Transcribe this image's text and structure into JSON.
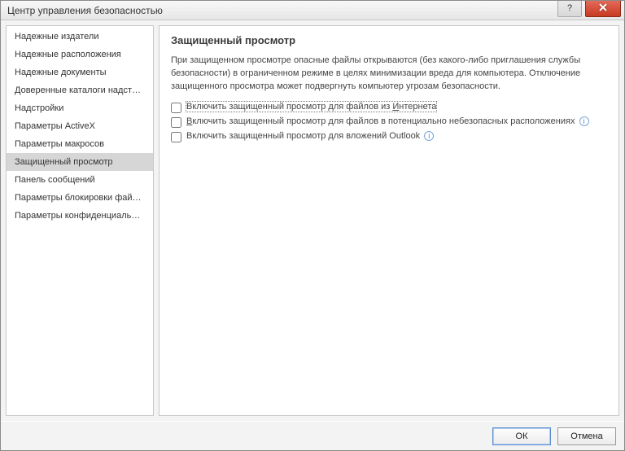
{
  "window": {
    "title": "Центр управления безопасностью"
  },
  "sidebar": {
    "items": [
      {
        "label": "Надежные издатели"
      },
      {
        "label": "Надежные расположения"
      },
      {
        "label": "Надежные документы"
      },
      {
        "label": "Доверенные каталоги надстроек"
      },
      {
        "label": "Надстройки"
      },
      {
        "label": "Параметры ActiveX"
      },
      {
        "label": "Параметры макросов"
      },
      {
        "label": "Защищенный просмотр"
      },
      {
        "label": "Панель сообщений"
      },
      {
        "label": "Параметры блокировки файлов"
      },
      {
        "label": "Параметры конфиденциальности"
      }
    ],
    "selected_index": 7
  },
  "content": {
    "heading": "Защищенный просмотр",
    "description": "При защищенном просмотре опасные файлы открываются (без какого-либо приглашения службы безопасности) в ограниченном режиме в целях минимизации вреда для компьютера. Отключение защищенного просмотра может подвергнуть компьютер угрозам безопасности.",
    "options": [
      {
        "prefix": "Включить защищенный просмотр для файлов из ",
        "accel": "И",
        "suffix": "нтернета",
        "checked": false,
        "info": false
      },
      {
        "prefix": "",
        "accel": "В",
        "suffix": "ключить защищенный просмотр для файлов в потенциально небезопасных расположениях",
        "checked": false,
        "info": true
      },
      {
        "prefix": "Включить защищенный просмотр для вложений Outlook",
        "accel": "",
        "suffix": "",
        "checked": false,
        "info": true
      }
    ]
  },
  "footer": {
    "ok": "ОК",
    "cancel": "Отмена"
  },
  "icons": {
    "help": "?",
    "info": "i"
  }
}
